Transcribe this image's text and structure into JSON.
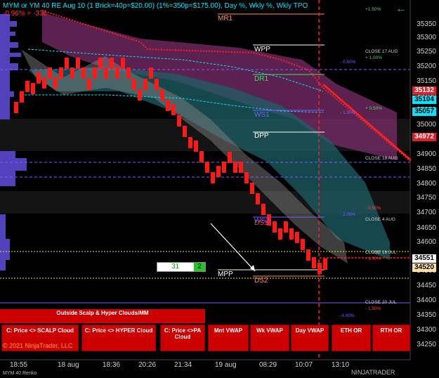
{
  "header": {
    "title": "MYM or YM 40 RE Aug 10 (1 Brick=40p=$20.00) (1%=350p=$175.00), Day %, Wkly %, Wkly TPO",
    "subtitle": "-0.96% = -336"
  },
  "price_axis": [
    "35350",
    "35300",
    "35250",
    "35200",
    "35150",
    "35100",
    "35050",
    "35000",
    "34950",
    "34900",
    "34850",
    "34800",
    "34750",
    "34700",
    "34650",
    "34600",
    "34500",
    "34450",
    "34400",
    "34350",
    "34300",
    "34250"
  ],
  "price_tags": [
    {
      "value": "35132",
      "bg": "#e0202a",
      "fg": "#ffffff"
    },
    {
      "value": "35104",
      "bg": "#00e5ff",
      "fg": "#000000"
    },
    {
      "value": "35057",
      "bg": "#00e5ff",
      "fg": "#000000"
    },
    {
      "value": "34972",
      "bg": "#e0202a",
      "fg": "#ffffff"
    },
    {
      "value": "34551",
      "bg": "#ffffff",
      "fg": "#000000"
    },
    {
      "value": "34520",
      "bg": "#ffe0a0",
      "fg": "#000000"
    }
  ],
  "pivots": {
    "mr1": "MR1",
    "wpp": "WPP",
    "dr1": "DR1",
    "ws1": "WS1",
    "dpp": "DPP",
    "ws2": "WS2",
    "ds1": "DS1",
    "mpp": "MPP",
    "ds2": "DS2"
  },
  "right_labels": {
    "p150": "+1.50%",
    "close17": "CLOSE 17 AUG",
    "p100": "+ 1.00%",
    "m050a": "- 0.50%",
    "p050": "+ 0.50%",
    "m100a": "- 1.00%",
    "close18": "CLOSE 18 AUG",
    "m050b": "- 0.50%",
    "m200": "- 2.00%",
    "close4": "CLOSE 4 AUG",
    "close19": "CLOSE 19 JUL",
    "m100b": "- 1.00%",
    "m300": "-3.00%",
    "close20": "CLOSE 20 JUL",
    "m150": "- 1.50%"
  },
  "counter": {
    "value": "31",
    "box": "2"
  },
  "outside_label": "Outside Scalp & Hyper Clouds/MM",
  "buttons": [
    "C: Price <> SCALP Cloud",
    "C: Price <> HYPER Cloud",
    "C: Price <>PA Cloud",
    "Mnt VWAP",
    "Wk VWAP",
    "Day VWAP",
    "ETH OR",
    "RTH OR"
  ],
  "time_axis": [
    "18:55",
    "18 aug",
    "18:36",
    "20:26",
    "21:34",
    "19 aug",
    "08:29",
    "10:07",
    "13:10"
  ],
  "copyright": "© 2021 NinjaTrader, LLC",
  "footer_left": "MYM 40 Renko",
  "footer_right": "NINJATRADER"
}
